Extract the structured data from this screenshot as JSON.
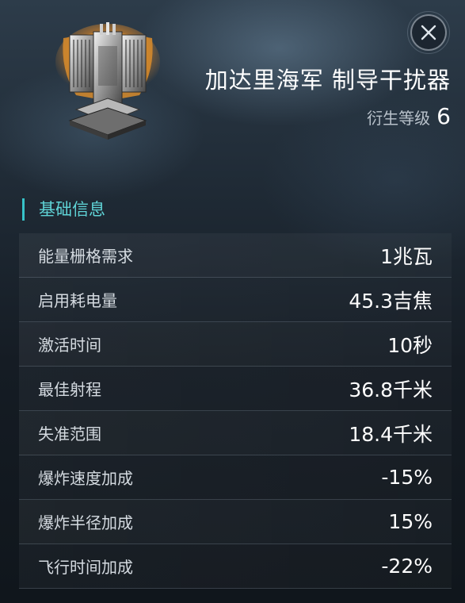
{
  "item": {
    "name": "加达里海军 制导干扰器",
    "meta_label": "衍生等级",
    "meta_value": "6",
    "icon": "guidance-disruptor-module-icon"
  },
  "close": {
    "icon": "close-icon"
  },
  "section": {
    "title": "基础信息"
  },
  "attributes": [
    {
      "label": "能量栅格需求",
      "value": "1兆瓦"
    },
    {
      "label": "启用耗电量",
      "value": "45.3吉焦"
    },
    {
      "label": "激活时间",
      "value": "10秒"
    },
    {
      "label": "最佳射程",
      "value": "36.8千米"
    },
    {
      "label": "失准范围",
      "value": "18.4千米"
    },
    {
      "label": "爆炸速度加成",
      "value": "-15%"
    },
    {
      "label": "爆炸半径加成",
      "value": "15%"
    },
    {
      "label": "飞行时间加成",
      "value": "-22%"
    }
  ],
  "colors": {
    "accent": "#37c3c9",
    "section_text": "#5fd3d6",
    "icon_glow": "#f0a040"
  }
}
